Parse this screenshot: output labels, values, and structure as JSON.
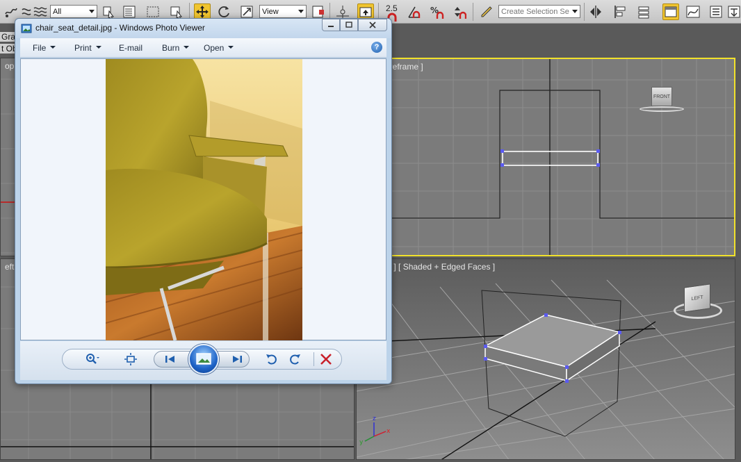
{
  "toolbar": {
    "selection_filter": "All",
    "ref_coord_system": "View",
    "snap_angle_value": "2.5",
    "named_selection_placeholder": "Create Selection Se",
    "colors": {
      "active_button": "#f0c530"
    }
  },
  "viewports": {
    "front": {
      "label": "nt ] [ Wireframe ]",
      "viewcube_label": "FRONT"
    },
    "perspective": {
      "label": "spective ] [ Shaded + Edged Faces ]",
      "viewcube_label": "LEFT"
    },
    "top": {
      "label": "op ]"
    },
    "left": {
      "label": "eft ]"
    },
    "left_strip_labels": [
      "Grap",
      "t Ob"
    ],
    "axis_labels": {
      "x": "x",
      "y": "y",
      "z": "z"
    },
    "colors": {
      "active_border": "#f2e22a",
      "selection_vertex": "#5b5bf0"
    }
  },
  "photo_viewer": {
    "title": "chair_seat_detail.jpg - Windows Photo Viewer",
    "menu": {
      "file": "File",
      "print": "Print",
      "email": "E-mail",
      "burn": "Burn",
      "open": "Open"
    },
    "help_icon": "?",
    "controls": {
      "zoom": "zoom-icon",
      "actual_size": "fit-window-icon",
      "previous": "previous-icon",
      "slideshow": "slideshow-icon",
      "next": "next-icon",
      "rotate_ccw": "rotate-counterclockwise-icon",
      "rotate_cw": "rotate-clockwise-icon",
      "delete": "delete-icon"
    }
  }
}
